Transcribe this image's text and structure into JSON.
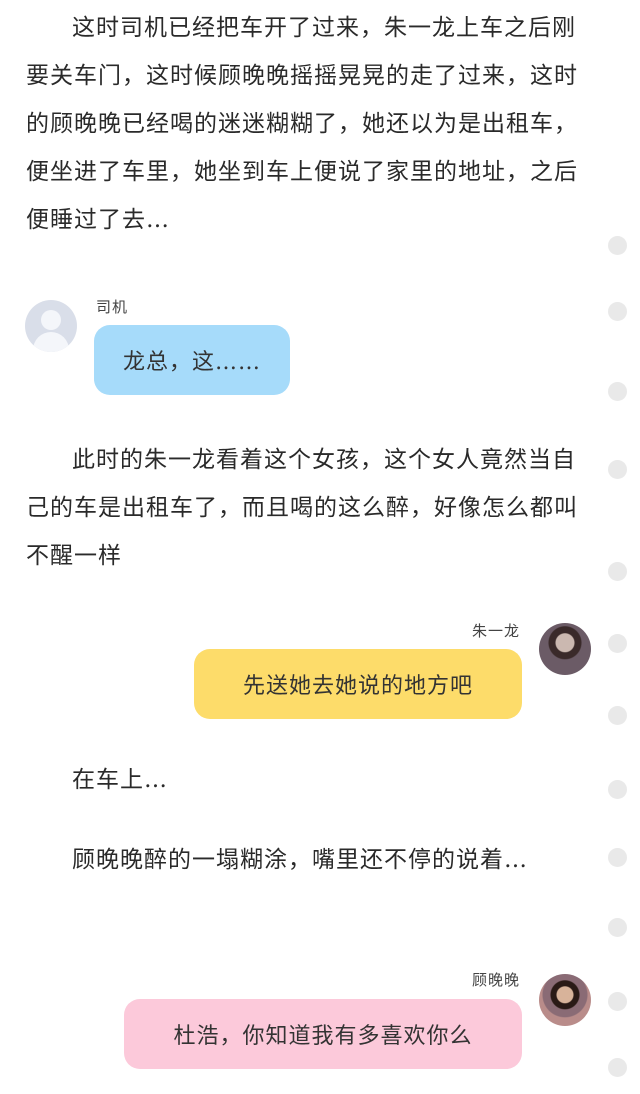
{
  "paragraphs": {
    "p1": "这时司机已经把车开了过来，朱一龙上车之后刚要关车门，这时候顾晚晚摇摇晃晃的走了过来，这时的顾晚晚已经喝的迷迷糊糊了，她还以为是出租车，便坐进了车里，她坐到车上便说了家里的地址，之后便睡过了去…",
    "p2": "此时的朱一龙看着这个女孩，这个女人竟然当自己的车是出租车了，而且喝的这么醉，好像怎么都叫不醒一样",
    "p3": "在车上…",
    "p4": "顾晚晚醉的一塌糊涂，嘴里还不停的说着…"
  },
  "messages": {
    "m1": {
      "speaker": "司机",
      "text": "龙总，这……",
      "color": "#a6dbfa"
    },
    "m2": {
      "speaker": "朱一龙",
      "text": "先送她去她说的地方吧",
      "color": "#fddc6a"
    },
    "m3": {
      "speaker": "顾晚晚",
      "text": "杜浩，你知道我有多喜欢你么",
      "color": "#fcc9da"
    }
  }
}
